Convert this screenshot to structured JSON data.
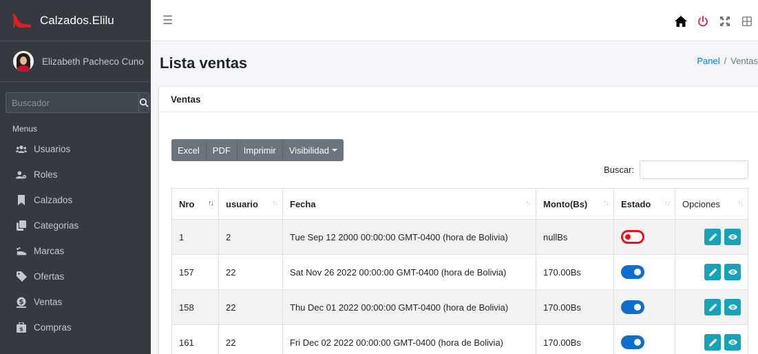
{
  "brand": {
    "name": "Calzados.Elilu"
  },
  "user": {
    "name": "Elizabeth Pacheco Cuno"
  },
  "sidebar_search": {
    "placeholder": "Buscador"
  },
  "menus_header": "Menus",
  "nav": [
    {
      "label": "Usuarios",
      "icon": "users-icon"
    },
    {
      "label": "Roles",
      "icon": "user-cog-icon"
    },
    {
      "label": "Calzados",
      "icon": "bookmark-icon"
    },
    {
      "label": "Categorias",
      "icon": "copy-icon"
    },
    {
      "label": "Marcas",
      "icon": "shoe-icon"
    },
    {
      "label": "Ofertas",
      "icon": "tag-icon"
    },
    {
      "label": "Ventas",
      "icon": "money-icon"
    },
    {
      "label": "Compras",
      "icon": "wallet-icon"
    }
  ],
  "page": {
    "title": "Lista ventas"
  },
  "breadcrumb": {
    "home": "Panel",
    "current": "Ventas"
  },
  "card": {
    "title": "Ventas"
  },
  "buttons": {
    "excel": "Excel",
    "pdf": "PDF",
    "print": "Imprimir",
    "visibility": "Visibilidad"
  },
  "table_search": {
    "label": "Buscar:"
  },
  "table": {
    "headers": [
      "Nro",
      "usuario",
      "Fecha",
      "Monto(Bs)",
      "Estado",
      "Opciones"
    ],
    "rows": [
      {
        "nro": "1",
        "usuario": "2",
        "fecha": "Tue Sep 12 2000 00:00:00 GMT-0400 (hora de Bolivia)",
        "monto": "nullBs",
        "estado": false
      },
      {
        "nro": "157",
        "usuario": "22",
        "fecha": "Sat Nov 26 2022 00:00:00 GMT-0400 (hora de Bolivia)",
        "monto": "170.00Bs",
        "estado": true
      },
      {
        "nro": "158",
        "usuario": "22",
        "fecha": "Thu Dec 01 2022 00:00:00 GMT-0400 (hora de Bolivia)",
        "monto": "170.00Bs",
        "estado": true
      },
      {
        "nro": "161",
        "usuario": "22",
        "fecha": "Fri Dec 02 2022 00:00:00 GMT-0400 (hora de Bolivia)",
        "monto": "170.00Bs",
        "estado": true
      }
    ]
  },
  "colors": {
    "sidebar": "#343a40",
    "accent": "#007bff",
    "info": "#17a2b8",
    "toggle_on": "#0d6ece",
    "toggle_off": "#e80f1e",
    "brand_red": "#e51b23"
  }
}
